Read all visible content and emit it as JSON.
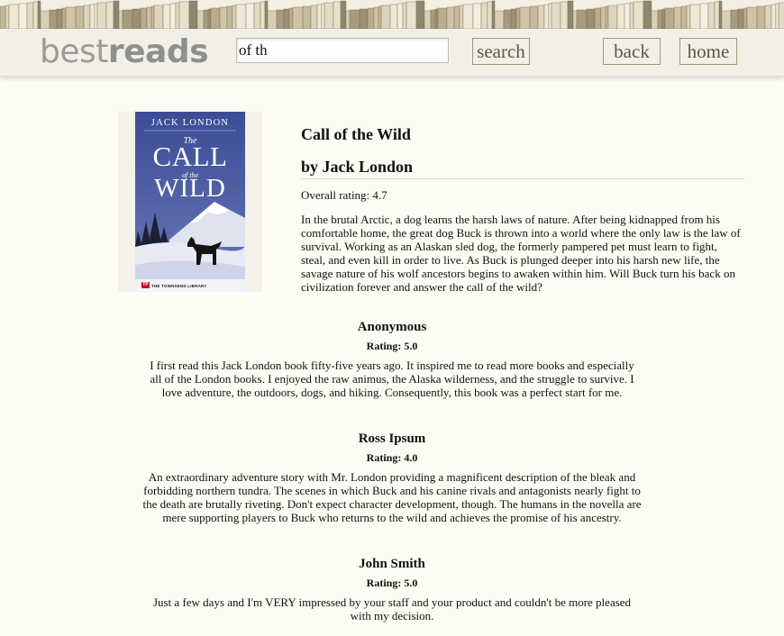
{
  "header": {
    "logo_light": "best",
    "logo_bold": "reads",
    "search_value": "of th",
    "search_button": "search",
    "back_button": "back",
    "home_button": "home"
  },
  "book": {
    "title": "Call of the Wild",
    "author_line": "by Jack London",
    "rating_line": "Overall rating: 4.7",
    "description": "In the brutal Arctic, a dog learns the harsh laws of nature. After being kidnapped from his comfortable home, the great dog Buck is thrown into a world where the only law is the law of survival. Working as an Alaskan sled dog, the formerly pampered pet must learn to fight, steal, and even kill in order to live. As Buck is plunged deeper into his harsh new life, the savage nature of his wolf ancestors begins to awaken within him. Will Buck turn his back on civilization forever and answer the call of the wild?",
    "cover": {
      "author": "JACK LONDON",
      "the": "The",
      "call": "CALL",
      "of_the": "of the",
      "wild": "WILD",
      "publisher_logo": "TP",
      "publisher": "THE TOWNSEND LIBRARY"
    }
  },
  "reviews": [
    {
      "name": "Anonymous",
      "rating": "Rating: 5.0",
      "text": "I first read this Jack London book fifty-five years ago. It inspired me to read more books and especially all of the London books. I enjoyed the raw animus, the Alaska wilderness, and the struggle to survive. I love adventure, the outdoors, dogs, and hiking. Consequently, this book was a perfect start for me."
    },
    {
      "name": "Ross Ipsum",
      "rating": "Rating: 4.0",
      "text": "An extraordinary adventure story with Mr. London providing a magnificent description of the bleak and forbidding northern tundra. The scenes in which Buck and his canine rivals and antagonists nearly fight to the death are brutally riveting. Don't expect character development, though. The humans in the novella are mere supporting players to Buck who returns to the wild and achieves the promise of his ancestry."
    },
    {
      "name": "John Smith",
      "rating": "Rating: 5.0",
      "text": "Just a few days and I'm VERY impressed by your staff and your product and couldn't be more pleased with my decision."
    }
  ],
  "colors": {
    "background": "#fdfcf4",
    "header_bar": "#f2f0e6",
    "button_border": "#9d957d",
    "button_text": "#5d5640",
    "logo": "#9a9a9a",
    "cover_blue": "#3d4f99"
  }
}
